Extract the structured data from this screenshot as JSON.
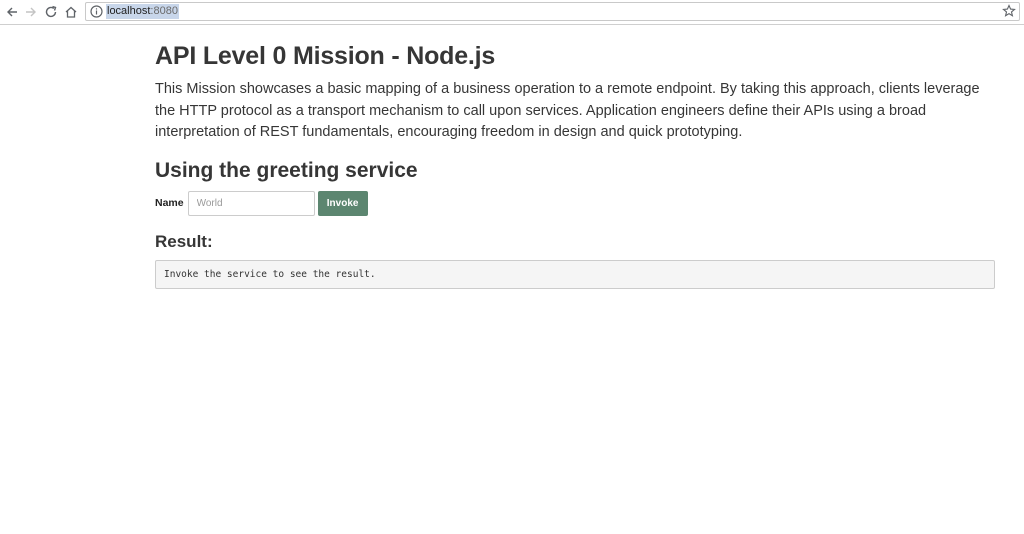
{
  "browser": {
    "url_host": "localhost",
    "url_port": ":8080",
    "back_icon": "arrow-left-icon",
    "forward_icon": "arrow-right-icon",
    "reload_icon": "reload-icon",
    "home_icon": "home-icon",
    "info_icon": "info-icon",
    "bookmark_icon": "star-icon"
  },
  "page": {
    "title": "API Level 0 Mission - Node.js",
    "description": "This Mission showcases a basic mapping of a business operation to a remote endpoint. By taking this approach, clients leverage the HTTP protocol as a transport mechanism to call upon services. Application engineers define their APIs using a broad interpretation of REST fundamentals, encouraging freedom in design and quick prototyping.",
    "section_title": "Using the greeting service",
    "form": {
      "name_label": "Name",
      "name_placeholder": "World",
      "name_value": "",
      "invoke_label": "Invoke"
    },
    "result_title": "Result:",
    "result_text": "Invoke the service to see the result."
  },
  "colors": {
    "invoke_button": "#5c8670",
    "text": "#363636",
    "result_background": "#f5f5f5"
  }
}
